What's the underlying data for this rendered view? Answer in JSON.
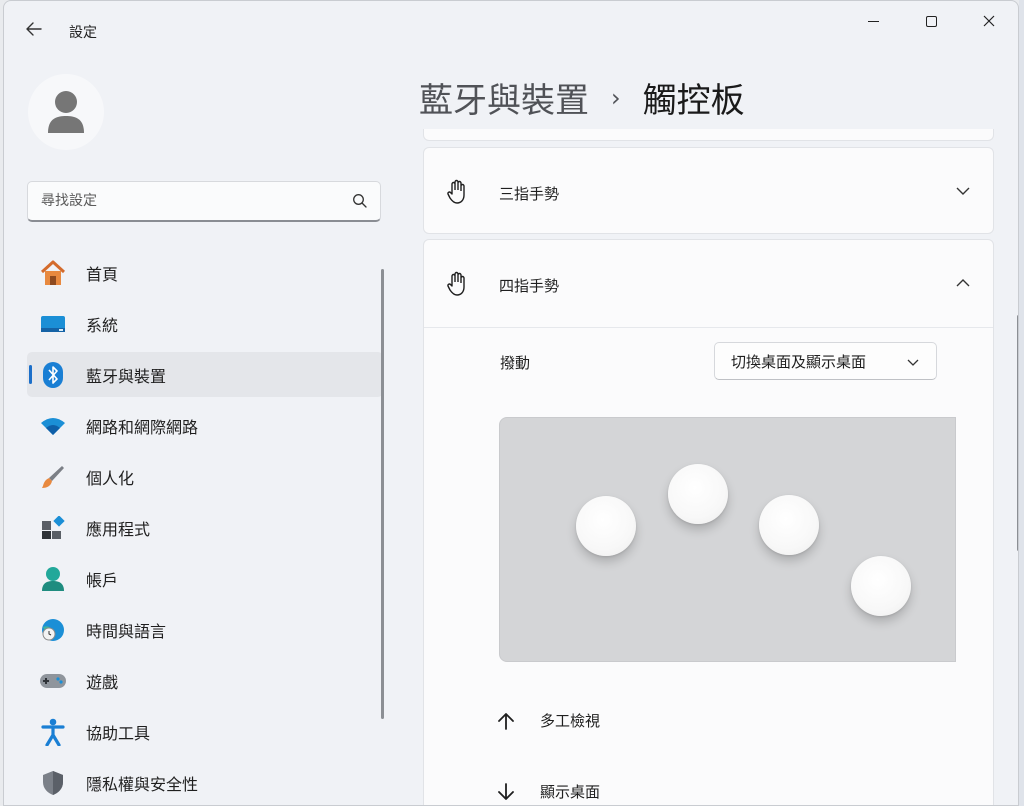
{
  "titlebar": {
    "app_title": "設定",
    "back_icon": "back-arrow-icon"
  },
  "search": {
    "placeholder": "尋找設定"
  },
  "nav": {
    "items": [
      {
        "label": "首頁",
        "icon": "home-icon"
      },
      {
        "label": "系統",
        "icon": "system-display-icon"
      },
      {
        "label": "藍牙與裝置",
        "icon": "bluetooth-icon",
        "selected": true
      },
      {
        "label": "網路和網際網路",
        "icon": "wifi-icon"
      },
      {
        "label": "個人化",
        "icon": "brush-icon"
      },
      {
        "label": "應用程式",
        "icon": "apps-icon"
      },
      {
        "label": "帳戶",
        "icon": "account-icon"
      },
      {
        "label": "時間與語言",
        "icon": "time-language-icon"
      },
      {
        "label": "遊戲",
        "icon": "gamepad-icon"
      },
      {
        "label": "協助工具",
        "icon": "accessibility-icon"
      },
      {
        "label": "隱私權與安全性",
        "icon": "shield-icon"
      }
    ]
  },
  "breadcrumb": {
    "parent": "藍牙與裝置",
    "separator": "›",
    "current": "觸控板"
  },
  "three_finger": {
    "label": "三指手勢",
    "expanded": false
  },
  "four_finger": {
    "label": "四指手勢",
    "expanded": true,
    "swipe_label": "撥動",
    "swipe_value": "切換桌面及顯示桌面",
    "actions": [
      {
        "direction": "up",
        "label": "多工檢視"
      },
      {
        "direction": "down",
        "label": "顯示桌面"
      }
    ]
  },
  "colors": {
    "accent": "#1c6fc9",
    "window_bg": "#f0f2f6",
    "card_bg": "#fbfbfc",
    "preview_bg": "#d4d5d7"
  }
}
